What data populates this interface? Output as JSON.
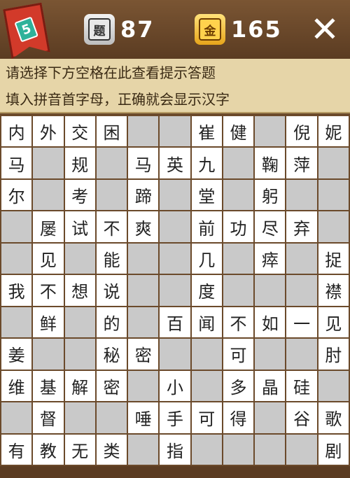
{
  "header": {
    "level": "5",
    "questions": {
      "icon": "question-tile-icon",
      "label": "题",
      "count": "87"
    },
    "gold": {
      "icon": "gold-coin-icon",
      "label": "金",
      "count": "165"
    },
    "close_icon": "close-icon"
  },
  "hints": {
    "line1": "请选择下方空格在此查看提示答题",
    "line2": "填入拼音首字母，正确就会显示汉字"
  },
  "grid": [
    [
      "内",
      "外",
      "交",
      "困",
      null,
      null,
      "崔",
      "健",
      null,
      "倪",
      "妮"
    ],
    [
      "马",
      null,
      "规",
      null,
      "马",
      "英",
      "九",
      null,
      "鞠",
      "萍",
      null
    ],
    [
      "尔",
      null,
      "考",
      null,
      "蹄",
      null,
      "堂",
      null,
      "躬",
      null,
      null
    ],
    [
      null,
      "屡",
      "试",
      "不",
      "爽",
      null,
      "前",
      "功",
      "尽",
      "弃",
      null
    ],
    [
      null,
      "见",
      null,
      "能",
      null,
      null,
      "几",
      null,
      "瘁",
      null,
      "捉"
    ],
    [
      "我",
      "不",
      "想",
      "说",
      null,
      null,
      "度",
      null,
      null,
      null,
      "襟"
    ],
    [
      null,
      "鲜",
      null,
      "的",
      null,
      "百",
      "闻",
      "不",
      "如",
      "一",
      "见"
    ],
    [
      "姜",
      null,
      null,
      "秘",
      "密",
      null,
      null,
      "可",
      null,
      null,
      "肘"
    ],
    [
      "维",
      "基",
      "解",
      "密",
      null,
      "小",
      null,
      "多",
      "晶",
      "硅",
      null
    ],
    [
      null,
      "督",
      null,
      null,
      "唾",
      "手",
      "可",
      "得",
      null,
      "谷",
      "歌"
    ],
    [
      "有",
      "教",
      "无",
      "类",
      null,
      "指",
      null,
      null,
      null,
      null,
      "剧"
    ]
  ]
}
